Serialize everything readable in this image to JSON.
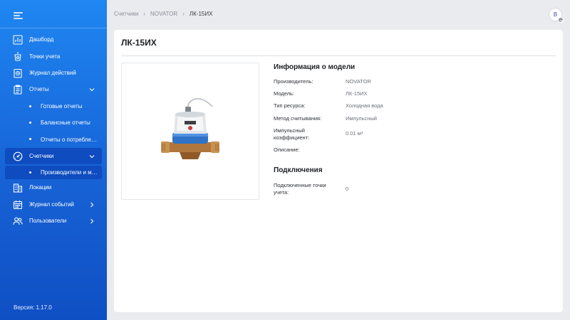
{
  "sidebar": {
    "items": [
      {
        "label": "Дашборд",
        "icon": "chart-icon"
      },
      {
        "label": "Точки учета",
        "icon": "meter-point-icon"
      },
      {
        "label": "Журнал действий",
        "icon": "action-log-icon"
      },
      {
        "label": "Отчеты",
        "icon": "clipboard-icon",
        "expanded": true
      },
      {
        "label": "Готовые отчеты"
      },
      {
        "label": "Балансные отчеты"
      },
      {
        "label": "Отчеты о потреблен..."
      },
      {
        "label": "Счетчики",
        "icon": "gauge-icon",
        "expanded": true,
        "active": true
      },
      {
        "label": "Производители и мо..."
      },
      {
        "label": "Локации",
        "icon": "building-icon"
      },
      {
        "label": "Журнал событий",
        "icon": "calendar-icon"
      },
      {
        "label": "Пользователи",
        "icon": "users-icon"
      }
    ],
    "version": "Версия: 1.17.0"
  },
  "header": {
    "breadcrumbs": [
      "Счетчики",
      "NOVATOR",
      "ЛК-15ИХ"
    ],
    "avatar_initial": "B"
  },
  "page": {
    "title": "ЛК-15ИХ",
    "model_info_title": "Информация о модели",
    "fields": [
      {
        "label": "Производитель:",
        "value": "NOVATOR"
      },
      {
        "label": "Модель:",
        "value": "ЛК-15ИХ"
      },
      {
        "label": "Тип ресурса:",
        "value": "Холодная вода"
      },
      {
        "label": "Метод считывания:",
        "value": "Импульсный"
      },
      {
        "label": "Импульсный коэффициент:",
        "value": "0.01 м³"
      },
      {
        "label": "Описание:",
        "value": ""
      }
    ],
    "connections_title": "Подключения",
    "connections": [
      {
        "label": "Подключенные точки учета:",
        "value": "0"
      }
    ]
  },
  "colors": {
    "sidebar_top": "#1f86f2",
    "sidebar_bottom": "#0f4fc4",
    "active_item": "#0e4cbf",
    "background": "#e9ebee"
  }
}
